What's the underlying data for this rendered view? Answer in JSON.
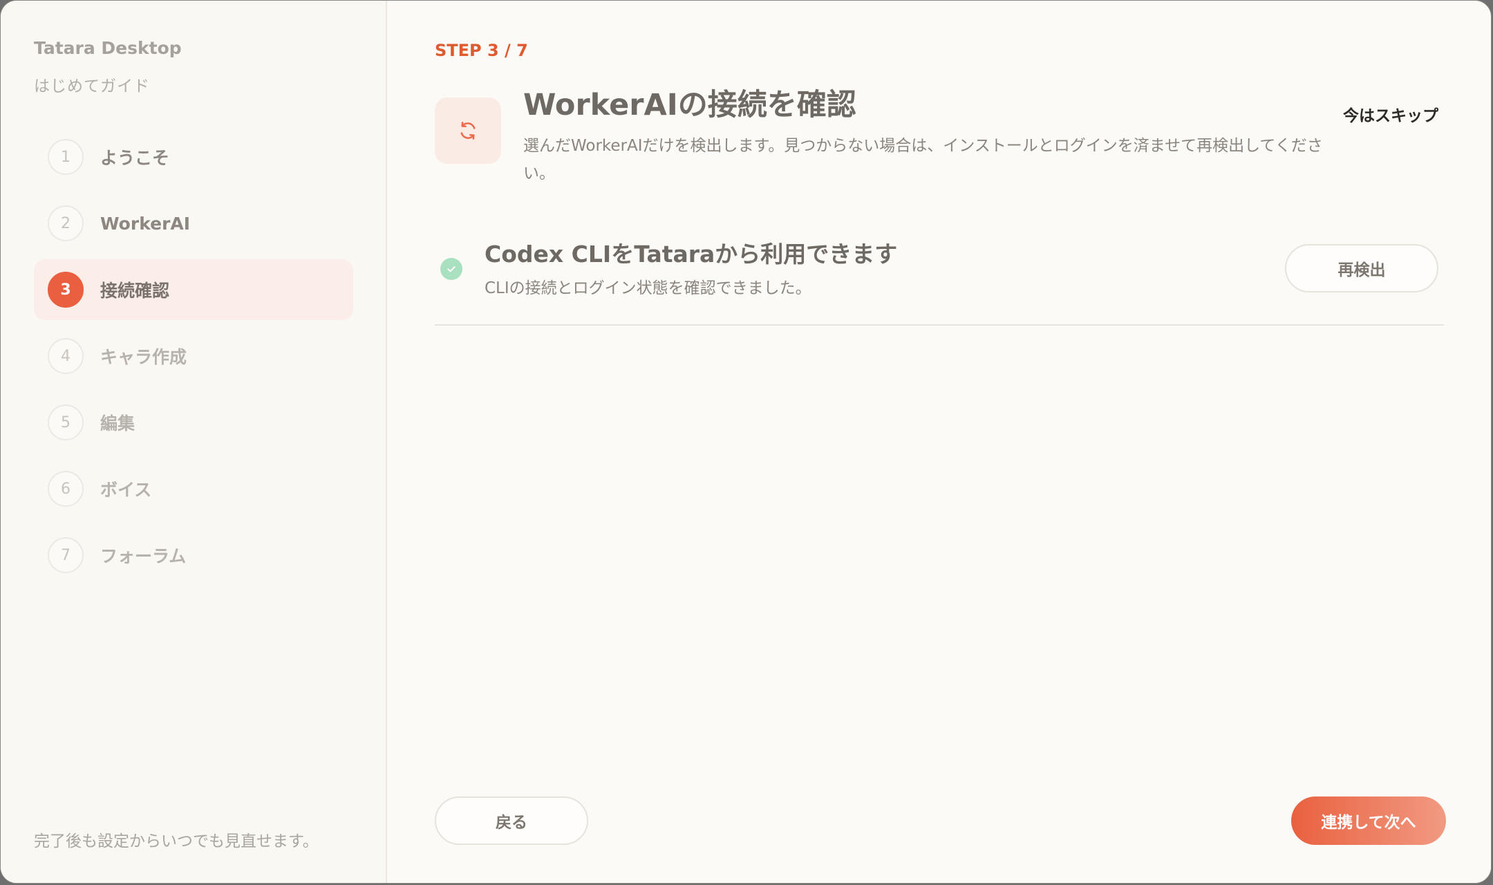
{
  "sidebar": {
    "app_name": "Tatara Desktop",
    "subtitle": "はじめてガイド",
    "items": [
      {
        "num": "1",
        "label": "ようこそ"
      },
      {
        "num": "2",
        "label": "WorkerAI"
      },
      {
        "num": "3",
        "label": "接続確認"
      },
      {
        "num": "4",
        "label": "キャラ作成"
      },
      {
        "num": "5",
        "label": "編集"
      },
      {
        "num": "6",
        "label": "ボイス"
      },
      {
        "num": "7",
        "label": "フォーラム"
      }
    ],
    "footnote": "完了後も設定からいつでも見直せます。"
  },
  "main": {
    "step": "STEP 3 / 7",
    "skip_label": "今はスキップ",
    "hero_icon": "refresh-icon",
    "title": "WorkerAIの接続を確認",
    "description": "選んだWorkerAIだけを検出します。見つからない場合は、インストールとログインを済ませて再検出してください。",
    "status": {
      "icon": "check-icon",
      "title": "Codex CLIをTataraから利用できます",
      "subtitle": "CLIの接続とログイン状態を確認できました。",
      "recheck_label": "再検出"
    },
    "back_label": "戻る",
    "next_label": "連携して次へ"
  },
  "colors": {
    "accent": "#e95f40",
    "success": "#a9e0bf",
    "background": "#fcfaf6"
  }
}
